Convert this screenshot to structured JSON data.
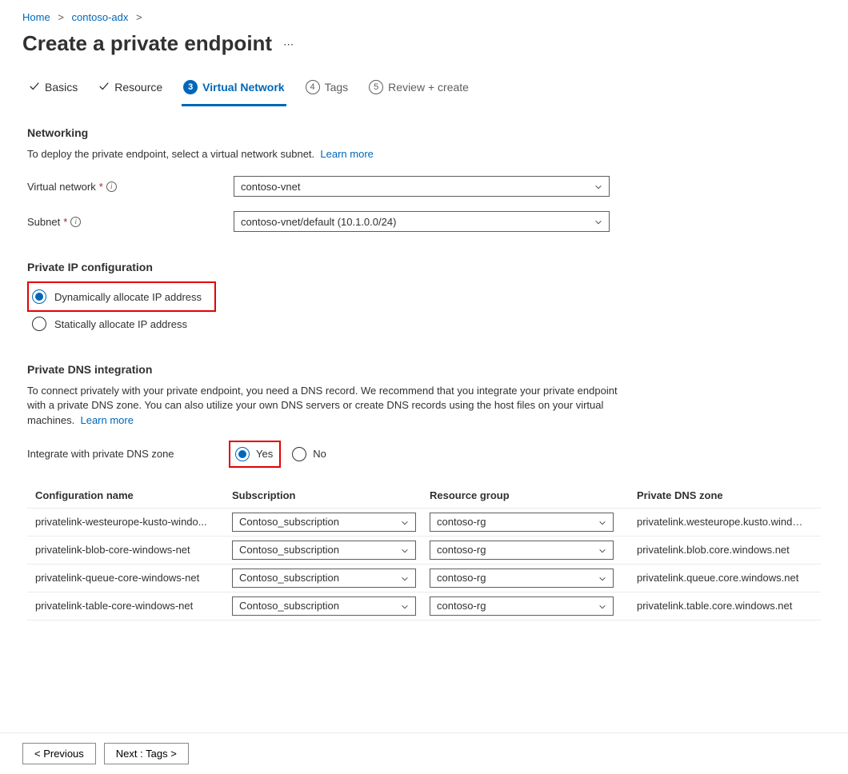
{
  "breadcrumb": {
    "items": [
      "Home",
      "contoso-adx"
    ],
    "separator": ">"
  },
  "page_title": "Create a private endpoint",
  "tabs": {
    "basics": "Basics",
    "resource": "Resource",
    "virtual_network": {
      "num": "3",
      "label": "Virtual Network"
    },
    "tags": {
      "num": "4",
      "label": "Tags"
    },
    "review": {
      "num": "5",
      "label": "Review + create"
    }
  },
  "networking": {
    "title": "Networking",
    "desc": "To deploy the private endpoint, select a virtual network subnet.",
    "learn_more": "Learn more",
    "vnet_label": "Virtual network",
    "vnet_value": "contoso-vnet",
    "subnet_label": "Subnet",
    "subnet_value": "contoso-vnet/default (10.1.0.0/24)"
  },
  "ipconfig": {
    "title": "Private IP configuration",
    "dynamic": "Dynamically allocate IP address",
    "static": "Statically allocate IP address"
  },
  "dns": {
    "title": "Private DNS integration",
    "desc": "To connect privately with your private endpoint, you need a DNS record. We recommend that you integrate your private endpoint with a private DNS zone. You can also utilize your own DNS servers or create DNS records using the host files on your virtual machines.",
    "learn_more": "Learn more",
    "integrate_label": "Integrate with private DNS zone",
    "yes": "Yes",
    "no": "No"
  },
  "dns_table": {
    "headers": {
      "config": "Configuration name",
      "sub": "Subscription",
      "rg": "Resource group",
      "zone": "Private DNS zone"
    },
    "rows": [
      {
        "config": "privatelink-westeurope-kusto-windo...",
        "sub": "Contoso_subscription",
        "rg": "contoso-rg",
        "zone": "privatelink.westeurope.kusto.window..."
      },
      {
        "config": "privatelink-blob-core-windows-net",
        "sub": "Contoso_subscription",
        "rg": "contoso-rg",
        "zone": "privatelink.blob.core.windows.net"
      },
      {
        "config": "privatelink-queue-core-windows-net",
        "sub": "Contoso_subscription",
        "rg": "contoso-rg",
        "zone": "privatelink.queue.core.windows.net"
      },
      {
        "config": "privatelink-table-core-windows-net",
        "sub": "Contoso_subscription",
        "rg": "contoso-rg",
        "zone": "privatelink.table.core.windows.net"
      }
    ]
  },
  "footer": {
    "previous": "< Previous",
    "next": "Next : Tags >"
  }
}
